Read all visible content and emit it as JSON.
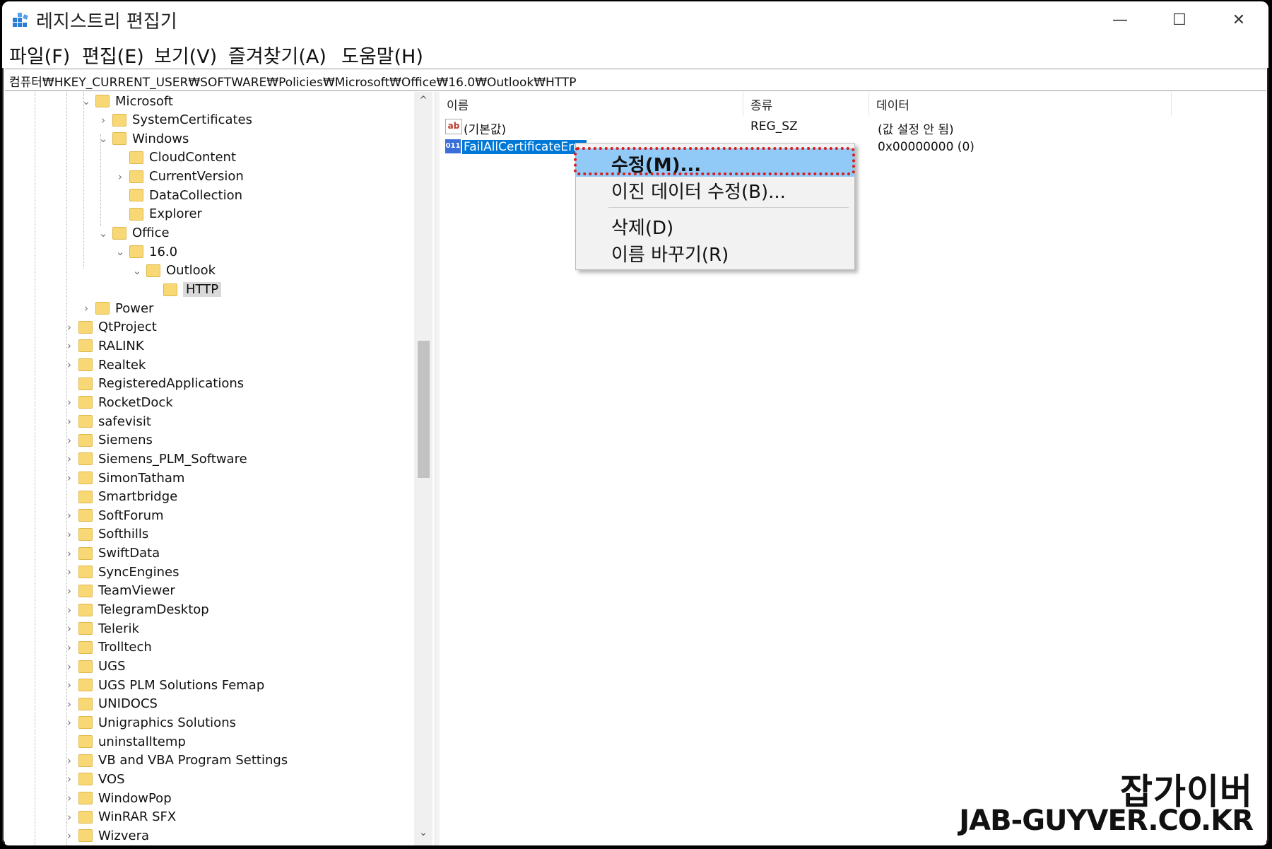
{
  "window": {
    "title": "레지스트리 편집기",
    "minimize": "—",
    "maximize": "☐",
    "close": "✕"
  },
  "menubar": [
    "파일(F)",
    "편집(E)",
    "보기(V)",
    "즐겨찾기(A)",
    "도움말(H)"
  ],
  "address": "컴퓨터₩HKEY_CURRENT_USER₩SOFTWARE₩Policies₩Microsoft₩Office₩16.0₩Outlook₩HTTP",
  "tree": [
    {
      "label": "Microsoft",
      "chev": "⌄"
    },
    {
      "label": "SystemCertificates",
      "chev": "›"
    },
    {
      "label": "Windows",
      "chev": "⌄"
    },
    {
      "label": "CloudContent",
      "chev": ""
    },
    {
      "label": "CurrentVersion",
      "chev": "›"
    },
    {
      "label": "DataCollection",
      "chev": ""
    },
    {
      "label": "Explorer",
      "chev": ""
    },
    {
      "label": "Office",
      "chev": "⌄"
    },
    {
      "label": "16.0",
      "chev": "⌄"
    },
    {
      "label": "Outlook",
      "chev": "⌄"
    },
    {
      "label": "HTTP",
      "chev": "",
      "selected": true
    },
    {
      "label": "Power",
      "chev": "›"
    },
    {
      "label": "QtProject",
      "chev": "›"
    },
    {
      "label": "RALINK",
      "chev": "›"
    },
    {
      "label": "Realtek",
      "chev": "›"
    },
    {
      "label": "RegisteredApplications",
      "chev": ""
    },
    {
      "label": "RocketDock",
      "chev": "›"
    },
    {
      "label": "safevisit",
      "chev": "›"
    },
    {
      "label": "Siemens",
      "chev": "›"
    },
    {
      "label": "Siemens_PLM_Software",
      "chev": "›"
    },
    {
      "label": "SimonTatham",
      "chev": "›"
    },
    {
      "label": "Smartbridge",
      "chev": ""
    },
    {
      "label": "SoftForum",
      "chev": "›"
    },
    {
      "label": "Softhills",
      "chev": "›"
    },
    {
      "label": "SwiftData",
      "chev": "›"
    },
    {
      "label": "SyncEngines",
      "chev": "›"
    },
    {
      "label": "TeamViewer",
      "chev": "›"
    },
    {
      "label": "TelegramDesktop",
      "chev": "›"
    },
    {
      "label": "Telerik",
      "chev": "›"
    },
    {
      "label": "Trolltech",
      "chev": "›"
    },
    {
      "label": "UGS",
      "chev": "›"
    },
    {
      "label": "UGS PLM Solutions Femap",
      "chev": "›"
    },
    {
      "label": "UNIDOCS",
      "chev": "›"
    },
    {
      "label": "Unigraphics Solutions",
      "chev": "›"
    },
    {
      "label": "uninstalltemp",
      "chev": ""
    },
    {
      "label": "VB and VBA Program Settings",
      "chev": "›"
    },
    {
      "label": "VOS",
      "chev": "›"
    },
    {
      "label": "WindowPop",
      "chev": "›"
    },
    {
      "label": "WinRAR SFX",
      "chev": "›"
    },
    {
      "label": "Wizvera",
      "chev": "›"
    }
  ],
  "scrollbar": {
    "up": "^",
    "down": "⌄"
  },
  "columns": {
    "name": "이름",
    "type": "종류",
    "data": "데이터"
  },
  "values": [
    {
      "icon": "ab",
      "name": "(기본값)",
      "type": "REG_SZ",
      "data": "(값 설정 안 됨)"
    },
    {
      "icon": "011",
      "name": "FailAllCertificateErro",
      "type": "",
      "data": "0x00000000 (0)"
    }
  ],
  "context_menu": {
    "modify": "수정(M)...",
    "modify_binary": "이진 데이터 수정(B)...",
    "delete": "삭제(D)",
    "rename": "이름 바꾸기(R)"
  },
  "watermark": {
    "ko": "잡가이버",
    "en": "JAB-GUYVER.CO.KR"
  },
  "colors": {
    "selection": "#0078d7",
    "menu_highlight": "#91c9f7",
    "annotation": "#d61c1c",
    "folder": "#f8d775"
  }
}
